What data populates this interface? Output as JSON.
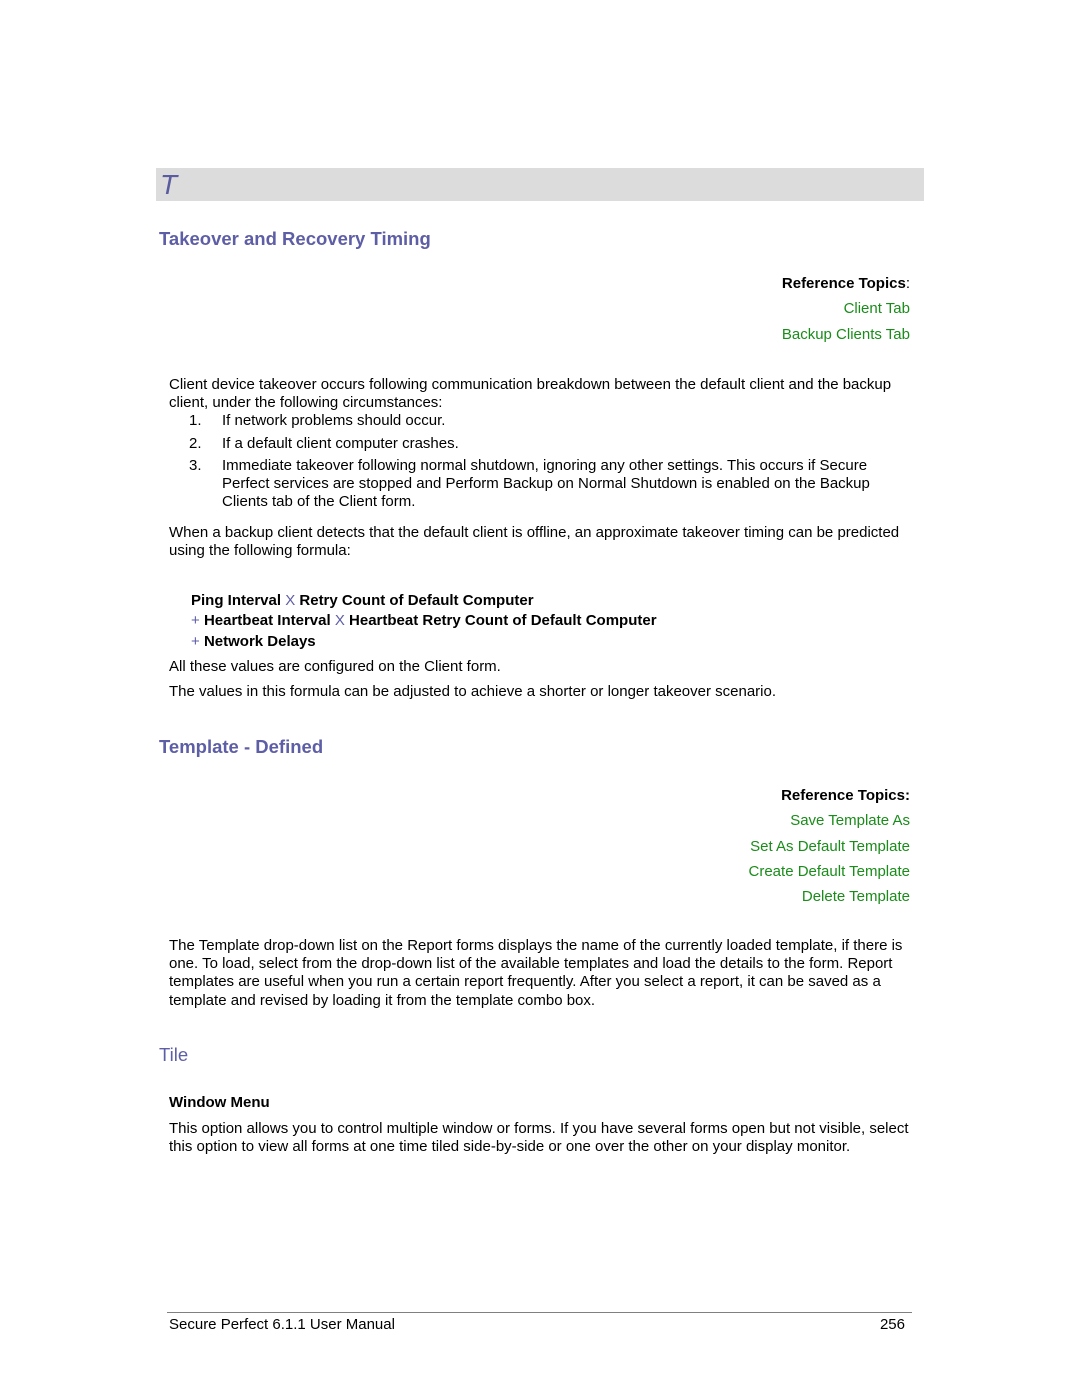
{
  "section_letter": "T",
  "colors": {
    "heading": "#5e5ea6",
    "link": "#1a8c1a",
    "band": "#dcdcdc"
  },
  "takeover": {
    "title": "Takeover and Recovery Timing",
    "ref_title": "Reference Topics",
    "ref_colon": ":",
    "ref_links": [
      "Client Tab",
      "Backup Clients Tab"
    ],
    "intro": "Client device takeover occurs following communication breakdown between the default client and the backup client, under the following circumstances:",
    "steps": [
      {
        "num": "1.",
        "text": "If network problems should occur."
      },
      {
        "num": "2.",
        "text": "If a default client computer crashes."
      },
      {
        "num": "3.",
        "text": "Immediate takeover following normal shutdown, ignoring any other settings. This occurs if Secure Perfect services are stopped and Perform Backup on Normal Shutdown is enabled on the Backup Clients tab of the Client form."
      }
    ],
    "formula_intro": "When a backup client detects that the default client is offline, an approximate takeover timing can be predicted using the following formula:",
    "formula": {
      "line1": {
        "a": "Ping Interval",
        "op": "X",
        "b": "Retry Count of Default Computer"
      },
      "line2": {
        "plus": "+",
        "a": "Heartbeat Interval",
        "op": "X",
        "b": "Heartbeat Retry Count of Default Computer"
      },
      "line3": {
        "plus": "+",
        "a": "Network Delays"
      }
    },
    "note1": "All these values are configured on the Client form.",
    "note2": "The values in this formula can be adjusted to achieve a shorter or longer takeover scenario."
  },
  "template": {
    "title": "Template - Defined",
    "ref_title": "Reference Topics:",
    "ref_links": [
      "Save Template As",
      "Set As Default Template",
      "Create Default Template",
      "Delete Template"
    ],
    "body": "The Template drop-down list on the Report forms displays the name of the currently loaded template, if there is one. To load, select from the drop-down list of the available templates and load the details to the form. Report templates are useful when you run a certain report frequently. After you select a report, it can be saved as a template and revised by loading it from the template combo box."
  },
  "tile": {
    "title": "Tile",
    "subhead": "Window Menu",
    "body": "This option allows you to control multiple window or forms. If you have several forms open but not visible, select this option to view all forms at one time tiled side-by-side or one over the other on your display monitor."
  },
  "footer": {
    "manual": "Secure Perfect 6.1.1 User Manual",
    "page": "256"
  }
}
